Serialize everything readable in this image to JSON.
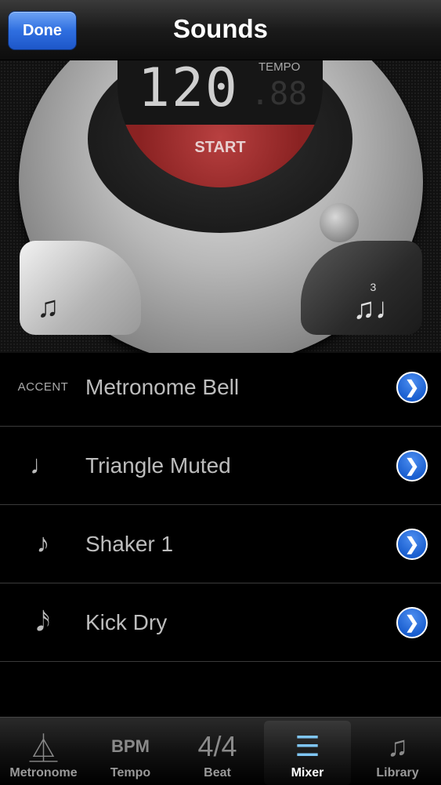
{
  "navbar": {
    "done_label": "Done",
    "title": "Sounds"
  },
  "dial": {
    "bpm_value": "120",
    "bpm_fraction": ".88",
    "tempo_label": "TEMPO",
    "start_label": "START",
    "left_button_icon": "eighth-notes-icon",
    "left_button_glyph": "♫",
    "right_button_icon": "triplet-icon",
    "right_button_glyph": "♫♩",
    "triplet_number": "3"
  },
  "sounds": [
    {
      "label": "ACCENT",
      "label_type": "text",
      "name": "Metronome Bell"
    },
    {
      "label": "♩",
      "label_type": "glyph",
      "label_icon": "quarter-note-icon",
      "name": "Triangle Muted"
    },
    {
      "label": "♪",
      "label_type": "glyph",
      "label_icon": "eighth-note-icon",
      "name": "Shaker 1"
    },
    {
      "label": "𝅘𝅥𝅯",
      "label_type": "glyph",
      "label_icon": "sixteenth-note-icon",
      "name": "Kick Dry"
    }
  ],
  "disclosure_glyph": "❯",
  "tabs": [
    {
      "label": "Metronome",
      "icon": "metronome-icon",
      "glyph": "⏅",
      "active": false
    },
    {
      "label": "Tempo",
      "icon": "bpm-icon",
      "glyph": "BPM",
      "active": false
    },
    {
      "label": "Beat",
      "icon": "time-signature-icon",
      "glyph": "4/4",
      "active": false
    },
    {
      "label": "Mixer",
      "icon": "mixer-icon",
      "glyph": "☰",
      "active": true
    },
    {
      "label": "Library",
      "icon": "music-note-icon",
      "glyph": "♫",
      "active": false
    }
  ],
  "colors": {
    "accent_blue": "#2f6fe0",
    "start_red": "#8a2222",
    "active_tab": "#7fc6f5"
  }
}
